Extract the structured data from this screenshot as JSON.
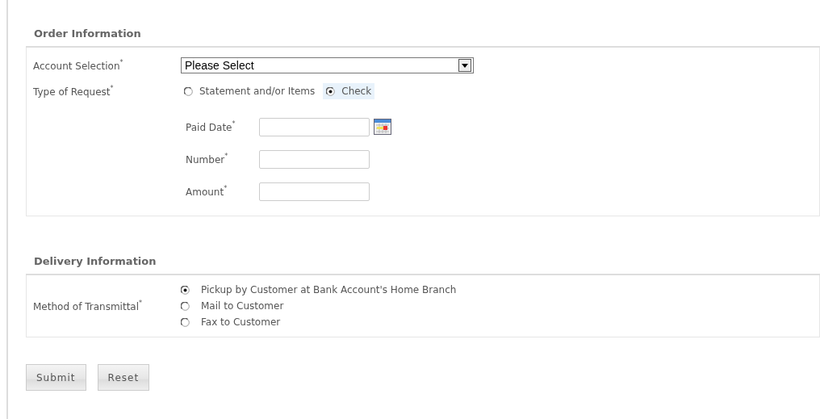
{
  "order_information": {
    "title": "Order Information",
    "account_selection": {
      "label": "Account Selection$^{*}$",
      "value": "Please Select"
    },
    "type_of_request": {
      "label": "Type of Request$^{*}$",
      "options": [
        {
          "label": "Statement and/or Items",
          "selected": false
        },
        {
          "label": "Check",
          "selected": true
        }
      ]
    },
    "check_fields": [
      {
        "label": "Paid Date$^{*}$",
        "kind": "date"
      },
      {
        "label": "Number$^{*}$",
        "kind": "text"
      },
      {
        "label": "Amount$^{*}$",
        "kind": "text"
      }
    ]
  },
  "delivery_information": {
    "title": "Delivery Information",
    "method_of_transmittal": {
      "label": "Method of Transmittal$^{*}$",
      "options": [
        {
          "label": "Pickup by Customer at Bank Account's Home Branch",
          "selected": true
        },
        {
          "label": "Mail to Customer",
          "selected": false
        },
        {
          "label": "Fax to Customer",
          "selected": false
        }
      ]
    }
  },
  "buttons": [
    "Submit",
    "Reset"
  ]
}
